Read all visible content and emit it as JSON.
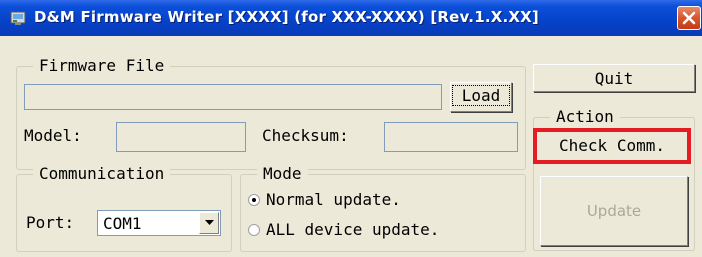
{
  "window": {
    "title": "D&M Firmware Writer [XXXX] (for XXX-XXXX) [Rev.1.X.XX]"
  },
  "firmware_file": {
    "legend": "Firmware File",
    "path_value": "",
    "load_label": "Load",
    "model_label": "Model:",
    "model_value": "",
    "checksum_label": "Checksum:",
    "checksum_value": ""
  },
  "communication": {
    "legend": "Communication",
    "port_label": "Port:",
    "port_selected": "COM1"
  },
  "mode": {
    "legend": "Mode",
    "options": [
      {
        "label": "Normal update.",
        "selected": true
      },
      {
        "label": "ALL device update.",
        "selected": false
      }
    ]
  },
  "actions": {
    "quit_label": "Quit",
    "legend": "Action",
    "check_comm_label": "Check Comm.",
    "update_label": "Update"
  },
  "colors": {
    "titlebar": "#0a47cf",
    "highlight": "#e61c24",
    "window_bg": "#ece9d8",
    "disabled_text": "#aca899"
  },
  "icons": {
    "app": "application-icon",
    "close": "close-icon",
    "combo": "chevron-down-icon"
  }
}
